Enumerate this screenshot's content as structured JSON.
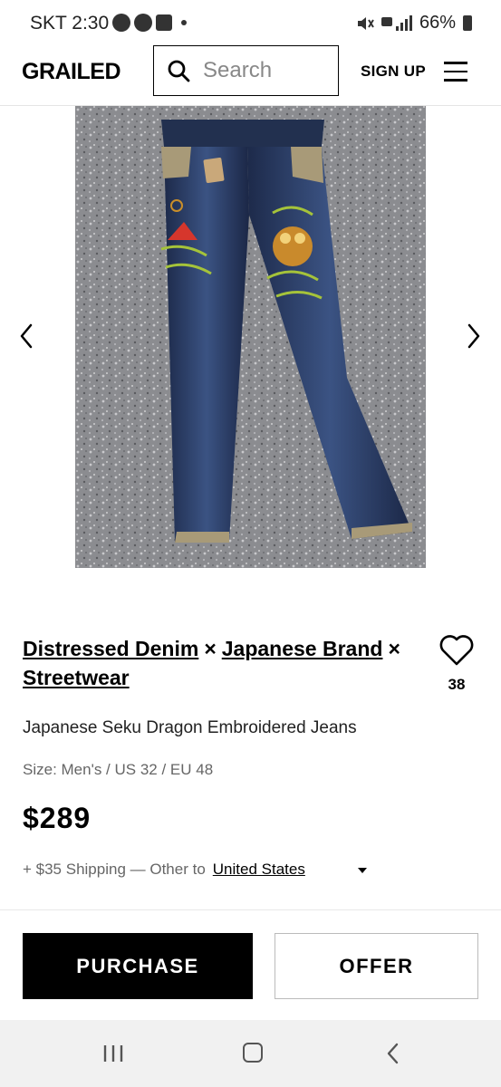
{
  "status_bar": {
    "time": "SKT 2:30",
    "battery": "66%"
  },
  "header": {
    "logo": "GRAILED",
    "search_placeholder": "Search",
    "signup": "SIGN UP"
  },
  "listing": {
    "brands": [
      "Distressed Denim",
      "Japanese Brand",
      "Streetwear"
    ],
    "separator": "×",
    "favorites_count": "38",
    "title": "Japanese Seku Dragon Embroidered Jeans",
    "size": "Size: Men's / US 32 / EU 48",
    "price": "$289",
    "shipping_prefix": "+ $35 Shipping — Other to",
    "shipping_country": "United States"
  },
  "actions": {
    "purchase": "PURCHASE",
    "offer": "OFFER"
  }
}
